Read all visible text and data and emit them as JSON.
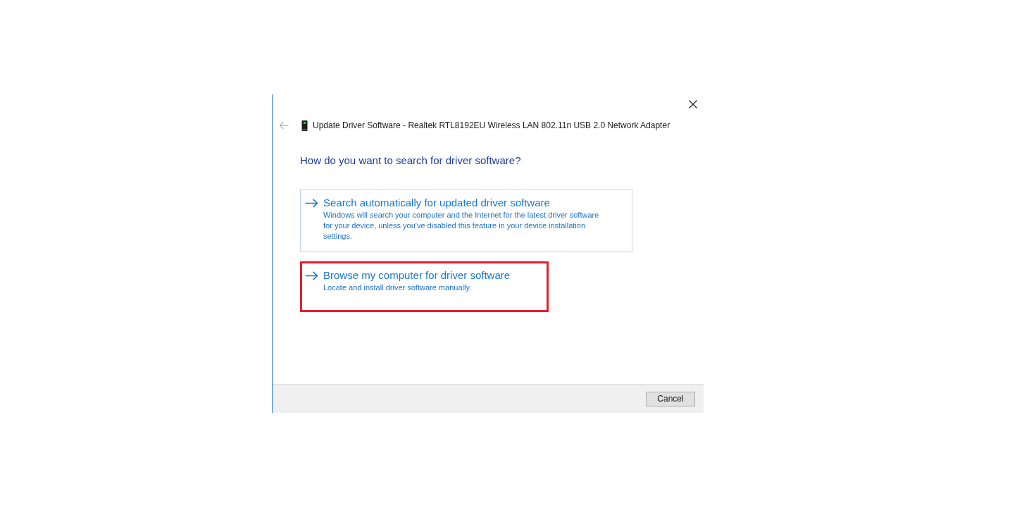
{
  "window": {
    "title": "Update Driver Software - Realtek RTL8192EU Wireless LAN 802.11n USB 2.0 Network Adapter",
    "back_button": {
      "disabled": true
    }
  },
  "heading": "How do you want to search for driver software?",
  "options": [
    {
      "title": "Search automatically for updated driver software",
      "description": "Windows will search your computer and the Internet for the latest driver software for your device, unless you've disabled this feature in your device installation settings.",
      "hovered": true,
      "highlighted": false
    },
    {
      "title": "Browse my computer for driver software",
      "description": "Locate and install driver software manually.",
      "hovered": false,
      "highlighted": true
    }
  ],
  "buttons": [
    "Cancel"
  ]
}
